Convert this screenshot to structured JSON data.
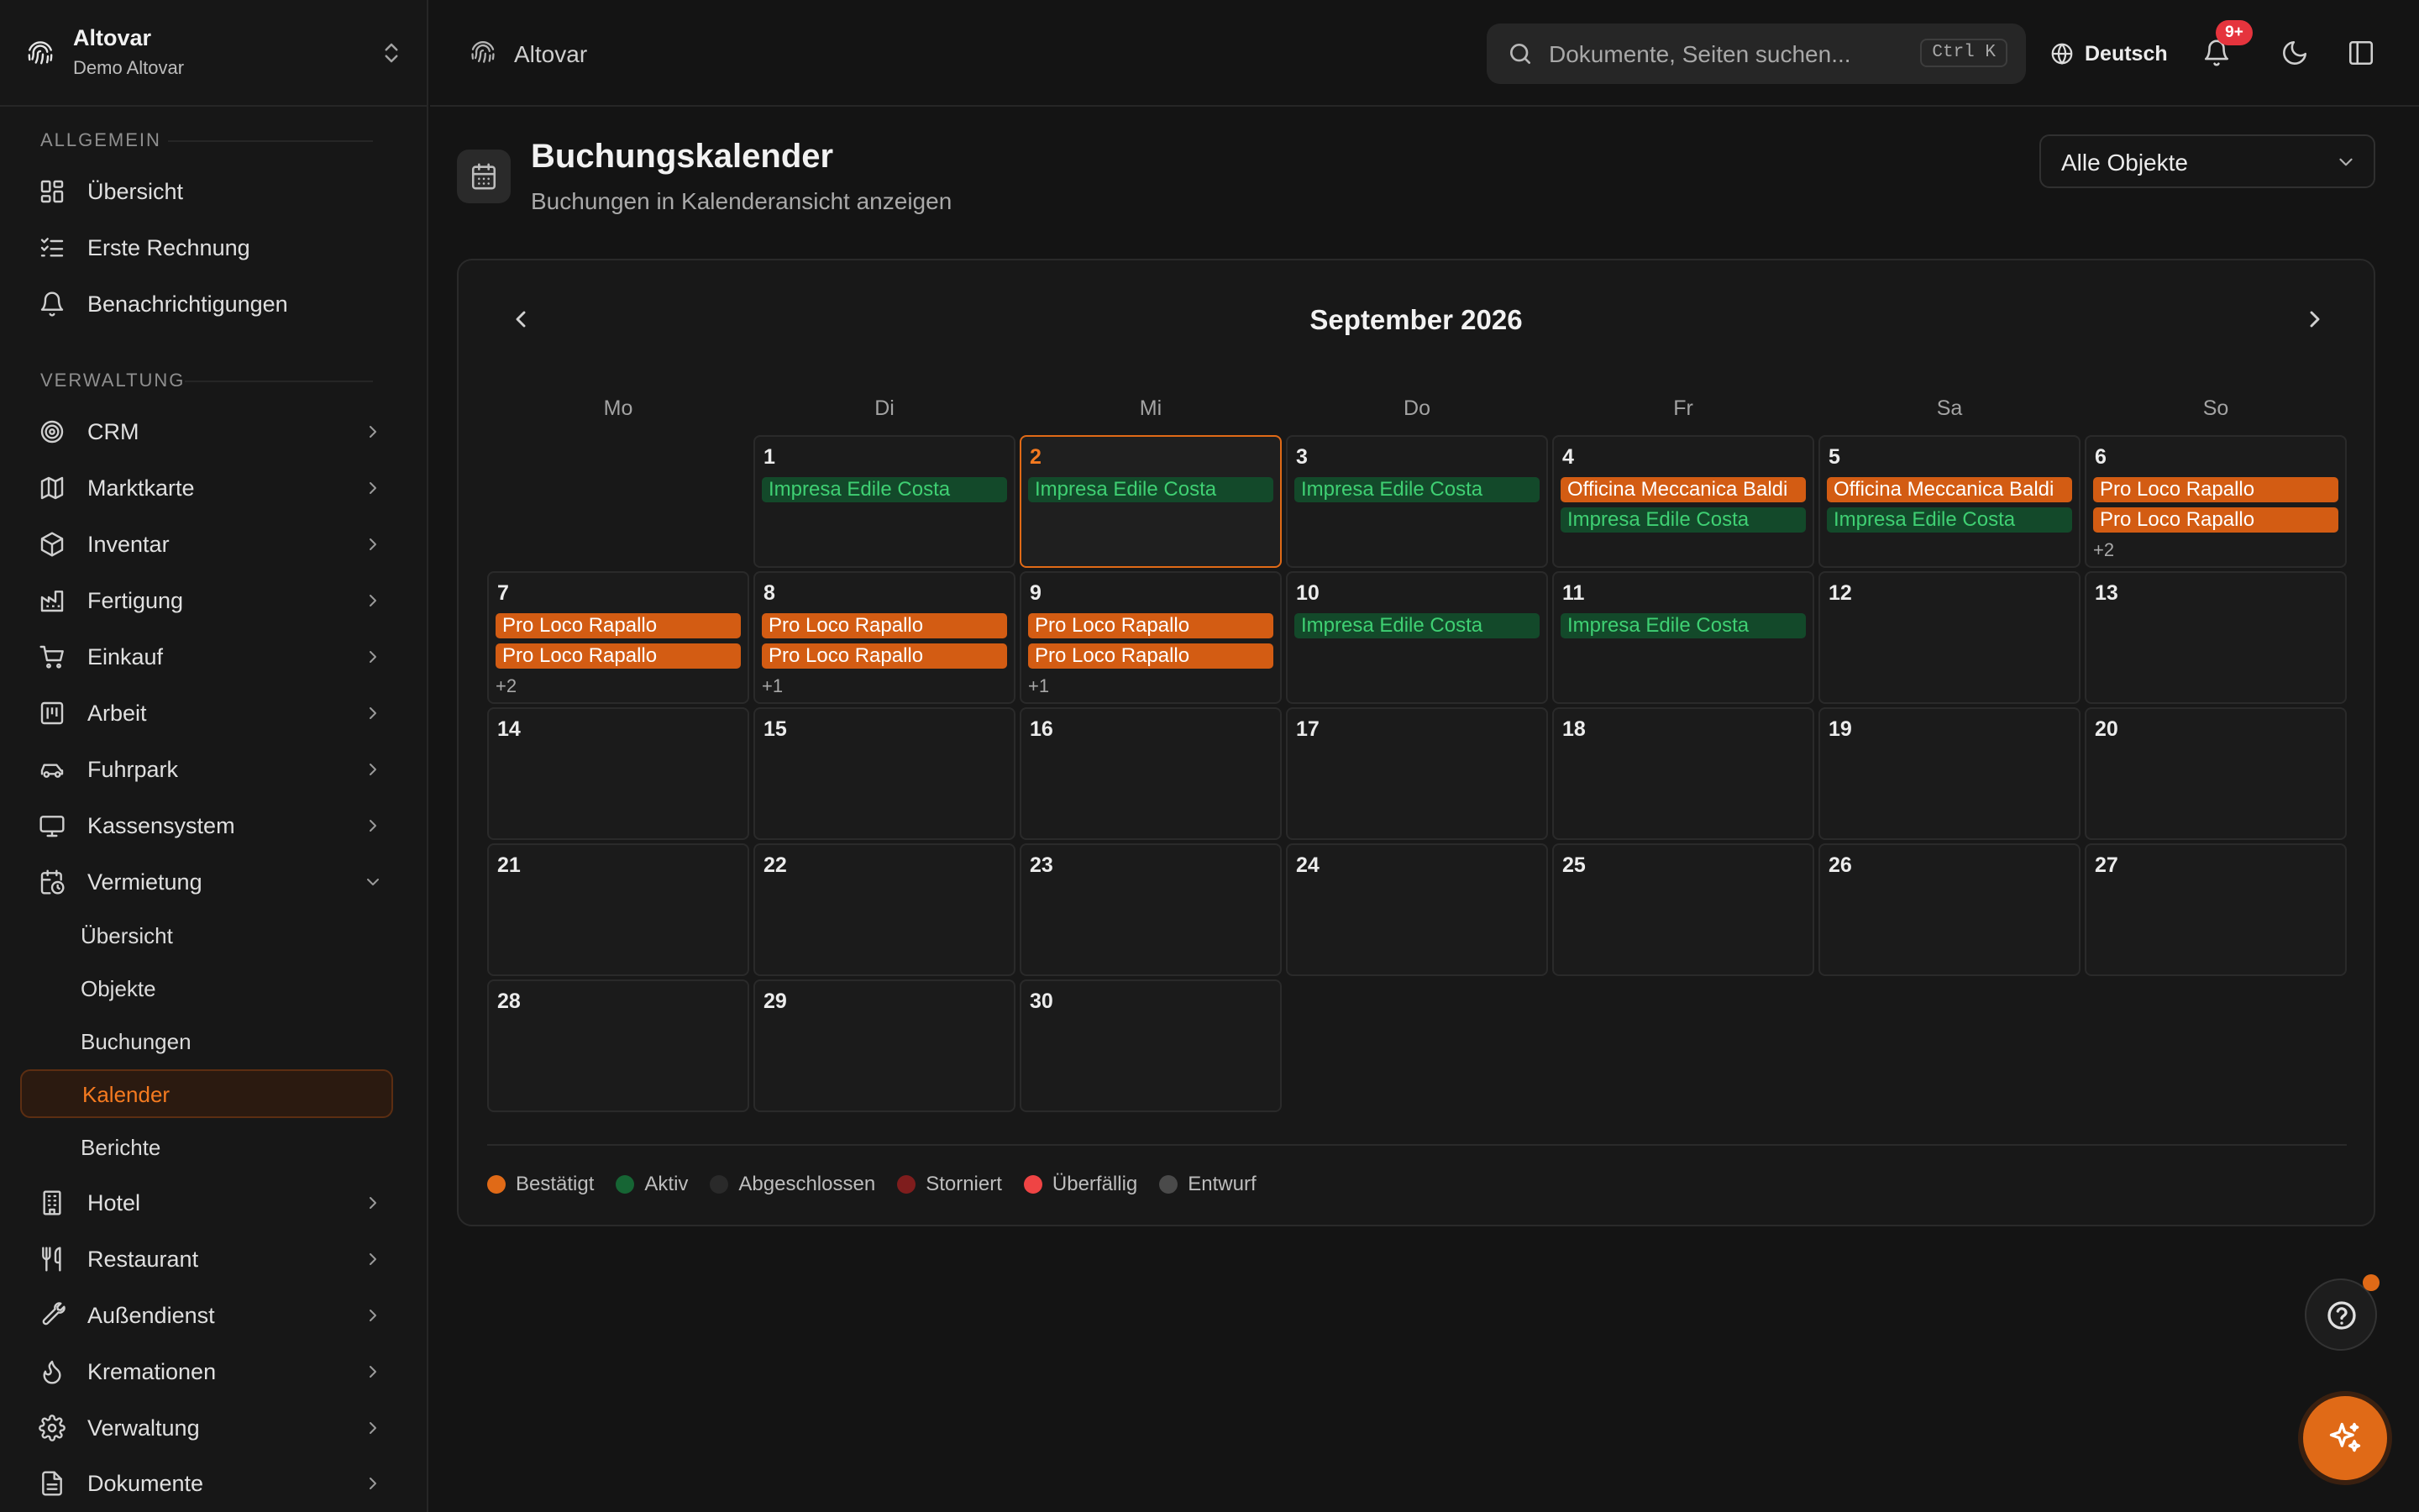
{
  "org": {
    "name": "Altovar",
    "subtitle": "Demo Altovar"
  },
  "sidebar": {
    "sections": [
      {
        "label": "Allgemein"
      },
      {
        "label": "Verwaltung"
      }
    ],
    "general": [
      {
        "label": "Übersicht",
        "icon": "dashboard-icon"
      },
      {
        "label": "Erste Rechnung",
        "icon": "checklist-icon"
      },
      {
        "label": "Benachrichtigungen",
        "icon": "bell-icon"
      }
    ],
    "management": [
      {
        "label": "CRM",
        "icon": "target-icon"
      },
      {
        "label": "Marktkarte",
        "icon": "map-icon"
      },
      {
        "label": "Inventar",
        "icon": "box-icon"
      },
      {
        "label": "Fertigung",
        "icon": "factory-icon"
      },
      {
        "label": "Einkauf",
        "icon": "cart-icon"
      },
      {
        "label": "Arbeit",
        "icon": "work-icon"
      },
      {
        "label": "Fuhrpark",
        "icon": "car-icon"
      },
      {
        "label": "Kassensystem",
        "icon": "monitor-icon"
      },
      {
        "label": "Vermietung",
        "icon": "calendar-clock-icon"
      }
    ],
    "rental_sub": [
      {
        "label": "Übersicht"
      },
      {
        "label": "Objekte"
      },
      {
        "label": "Buchungen"
      },
      {
        "label": "Kalender"
      },
      {
        "label": "Berichte"
      }
    ],
    "more": [
      {
        "label": "Hotel",
        "icon": "building-icon"
      },
      {
        "label": "Restaurant",
        "icon": "utensils-icon"
      },
      {
        "label": "Außendienst",
        "icon": "wrench-icon"
      },
      {
        "label": "Kremationen",
        "icon": "flame-icon"
      },
      {
        "label": "Verwaltung",
        "icon": "gear-icon"
      },
      {
        "label": "Dokumente",
        "icon": "document-icon"
      }
    ]
  },
  "topbar": {
    "breadcrumb": "Altovar",
    "search_placeholder": "Dokumente, Seiten suchen...",
    "search_shortcut": "Ctrl K",
    "language": "Deutsch",
    "notification_count": "9+"
  },
  "page": {
    "title": "Buchungskalender",
    "subtitle": "Buchungen in Kalenderansicht anzeigen",
    "filter": "Alle Objekte"
  },
  "calendar": {
    "month": "September 2026",
    "weekdays": [
      "Mo",
      "Di",
      "Mi",
      "Do",
      "Fr",
      "Sa",
      "So"
    ],
    "first_weekday_index": 1,
    "days_in_month": 30,
    "today": 2,
    "events": {
      "1": [
        {
          "label": "Impresa Edile Costa",
          "status": "green"
        }
      ],
      "2": [
        {
          "label": "Impresa Edile Costa",
          "status": "green"
        }
      ],
      "3": [
        {
          "label": "Impresa Edile Costa",
          "status": "green"
        }
      ],
      "4": [
        {
          "label": "Officina Meccanica Baldi",
          "status": "orange"
        },
        {
          "label": "Impresa Edile Costa",
          "status": "green"
        }
      ],
      "5": [
        {
          "label": "Officina Meccanica Baldi",
          "status": "orange"
        },
        {
          "label": "Impresa Edile Costa",
          "status": "green"
        }
      ],
      "6": [
        {
          "label": "Pro Loco Rapallo",
          "status": "orange"
        },
        {
          "label": "Pro Loco Rapallo",
          "status": "orange"
        }
      ],
      "7": [
        {
          "label": "Pro Loco Rapallo",
          "status": "orange"
        },
        {
          "label": "Pro Loco Rapallo",
          "status": "orange"
        }
      ],
      "8": [
        {
          "label": "Pro Loco Rapallo",
          "status": "orange"
        },
        {
          "label": "Pro Loco Rapallo",
          "status": "orange"
        }
      ],
      "9": [
        {
          "label": "Pro Loco Rapallo",
          "status": "orange"
        },
        {
          "label": "Pro Loco Rapallo",
          "status": "orange"
        }
      ],
      "10": [
        {
          "label": "Impresa Edile Costa",
          "status": "green"
        }
      ],
      "11": [
        {
          "label": "Impresa Edile Costa",
          "status": "green"
        }
      ]
    },
    "more": {
      "6": "+2",
      "7": "+2",
      "8": "+1",
      "9": "+1"
    },
    "legend": [
      {
        "label": "Bestätigt",
        "color": "#e06a17"
      },
      {
        "label": "Aktiv",
        "color": "#166534"
      },
      {
        "label": "Abgeschlossen",
        "color": "#2a2a2a"
      },
      {
        "label": "Storniert",
        "color": "#7f1d1d"
      },
      {
        "label": "Überfällig",
        "color": "#ef4444"
      },
      {
        "label": "Entwurf",
        "color": "#4a4a4a"
      }
    ]
  }
}
